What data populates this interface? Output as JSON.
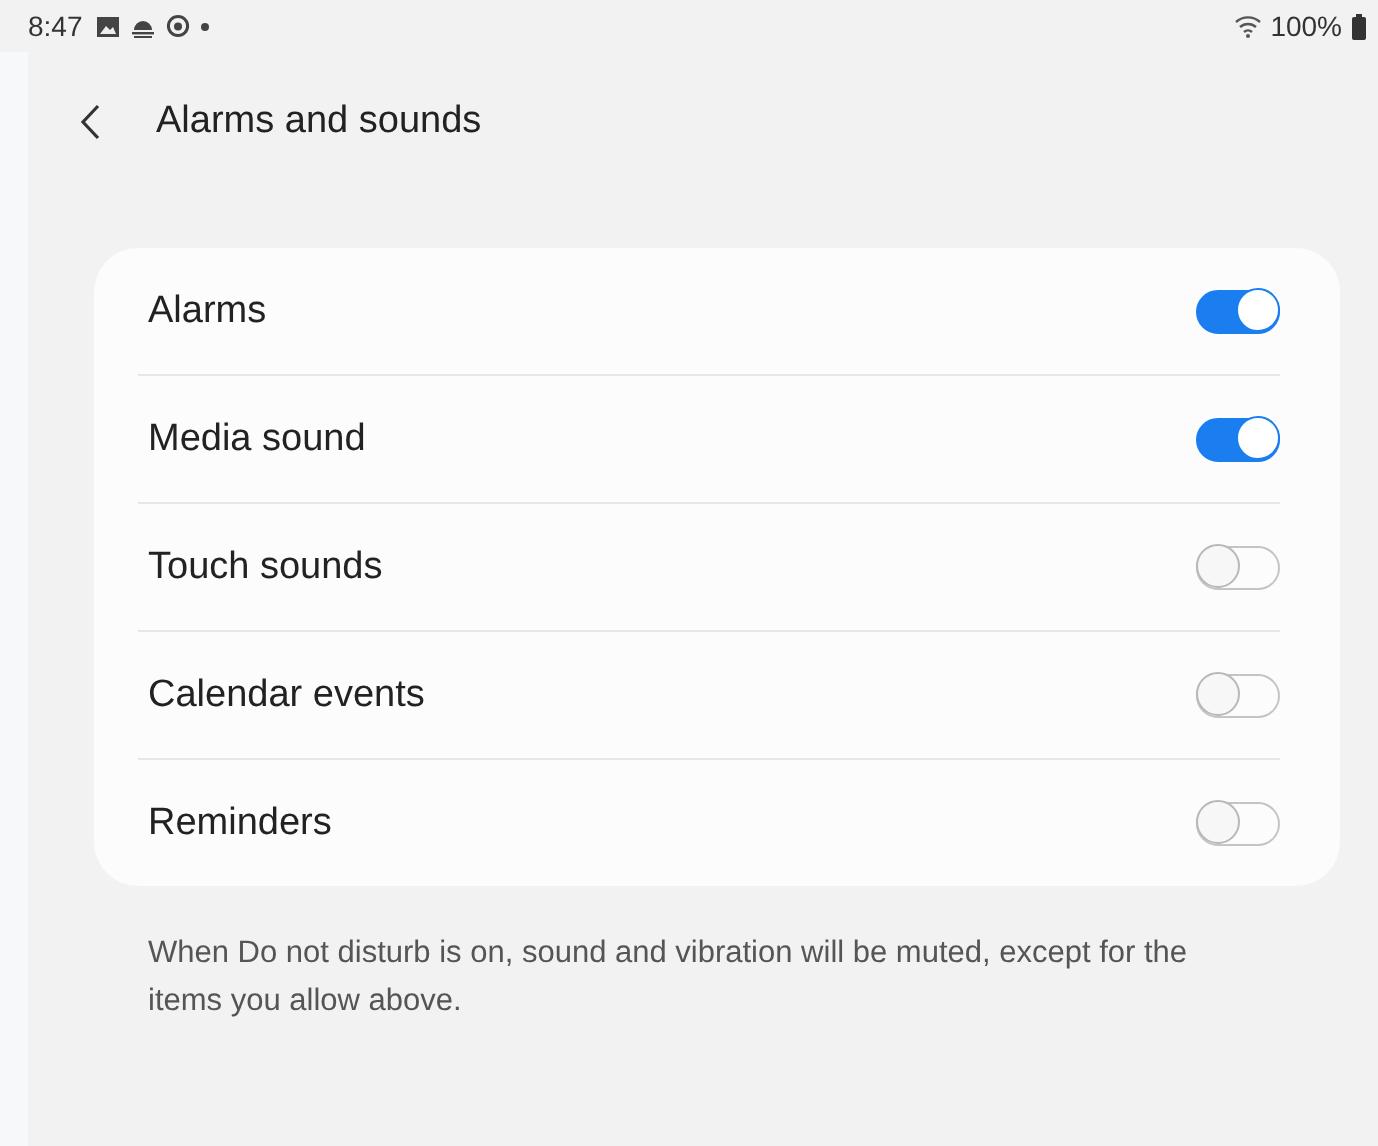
{
  "status_bar": {
    "time": "8:47",
    "battery": "100%"
  },
  "header": {
    "title": "Alarms and sounds"
  },
  "settings": [
    {
      "label": "Alarms",
      "on": true
    },
    {
      "label": "Media sound",
      "on": true
    },
    {
      "label": "Touch sounds",
      "on": false
    },
    {
      "label": "Calendar events",
      "on": false
    },
    {
      "label": "Reminders",
      "on": false
    }
  ],
  "note": "When Do not disturb is on, sound and vibration will be muted, except for the items you allow above."
}
